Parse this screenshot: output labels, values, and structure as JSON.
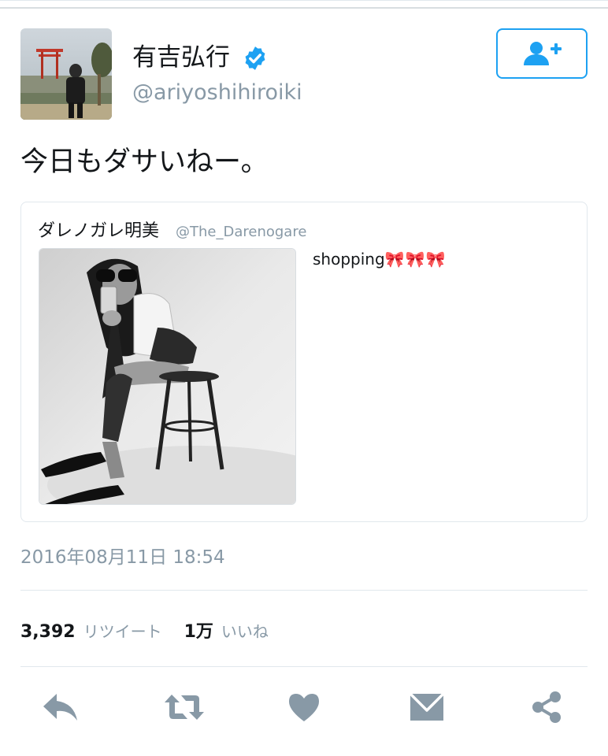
{
  "user": {
    "display_name": "有吉弘行",
    "handle": "@ariyoshihiroiki",
    "verified": true
  },
  "tweet": {
    "text": "今日もダサいねー。",
    "timestamp": "2016年08月11日 18:54"
  },
  "quoted_tweet": {
    "display_name": "ダレノガレ明美",
    "handle": "@The_Darenogare",
    "text": "shopping",
    "emoji": "🎀🎀🎀"
  },
  "stats": {
    "retweet_count": "3,392",
    "retweet_label": "リツイート",
    "like_count": "1万",
    "like_label": "いいね"
  },
  "icons": {
    "follow": "add-user-icon",
    "verified": "verified-badge-icon",
    "reply": "reply-icon",
    "retweet": "retweet-icon",
    "like": "heart-icon",
    "message": "envelope-icon",
    "share": "share-icon"
  },
  "colors": {
    "accent": "#1da1f2",
    "icon_gray": "#8899a6",
    "text": "#14171a"
  }
}
